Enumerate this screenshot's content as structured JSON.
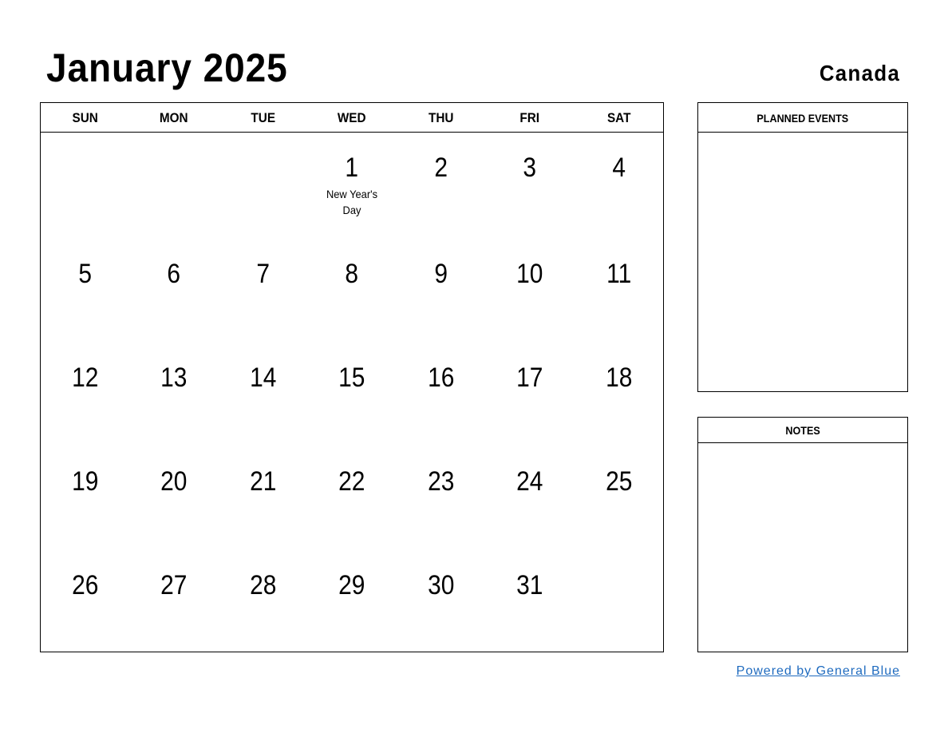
{
  "header": {
    "title": "January 2025",
    "country": "Canada"
  },
  "calendar": {
    "weekdays": [
      "SUN",
      "MON",
      "TUE",
      "WED",
      "THU",
      "FRI",
      "SAT"
    ],
    "weeks": [
      [
        {
          "d": ""
        },
        {
          "d": ""
        },
        {
          "d": ""
        },
        {
          "d": "1",
          "holiday": "New Year's Day"
        },
        {
          "d": "2"
        },
        {
          "d": "3"
        },
        {
          "d": "4"
        }
      ],
      [
        {
          "d": "5"
        },
        {
          "d": "6"
        },
        {
          "d": "7"
        },
        {
          "d": "8"
        },
        {
          "d": "9"
        },
        {
          "d": "10"
        },
        {
          "d": "11"
        }
      ],
      [
        {
          "d": "12"
        },
        {
          "d": "13"
        },
        {
          "d": "14"
        },
        {
          "d": "15"
        },
        {
          "d": "16"
        },
        {
          "d": "17"
        },
        {
          "d": "18"
        }
      ],
      [
        {
          "d": "19"
        },
        {
          "d": "20"
        },
        {
          "d": "21"
        },
        {
          "d": "22"
        },
        {
          "d": "23"
        },
        {
          "d": "24"
        },
        {
          "d": "25"
        }
      ],
      [
        {
          "d": "26"
        },
        {
          "d": "27"
        },
        {
          "d": "28"
        },
        {
          "d": "29"
        },
        {
          "d": "30"
        },
        {
          "d": "31"
        },
        {
          "d": ""
        }
      ]
    ]
  },
  "side": {
    "events_title": "PLANNED EVENTS",
    "notes_title": "NOTES"
  },
  "footer": {
    "powered_by": "Powered by General Blue",
    "link_color": "#1f6bbf"
  }
}
